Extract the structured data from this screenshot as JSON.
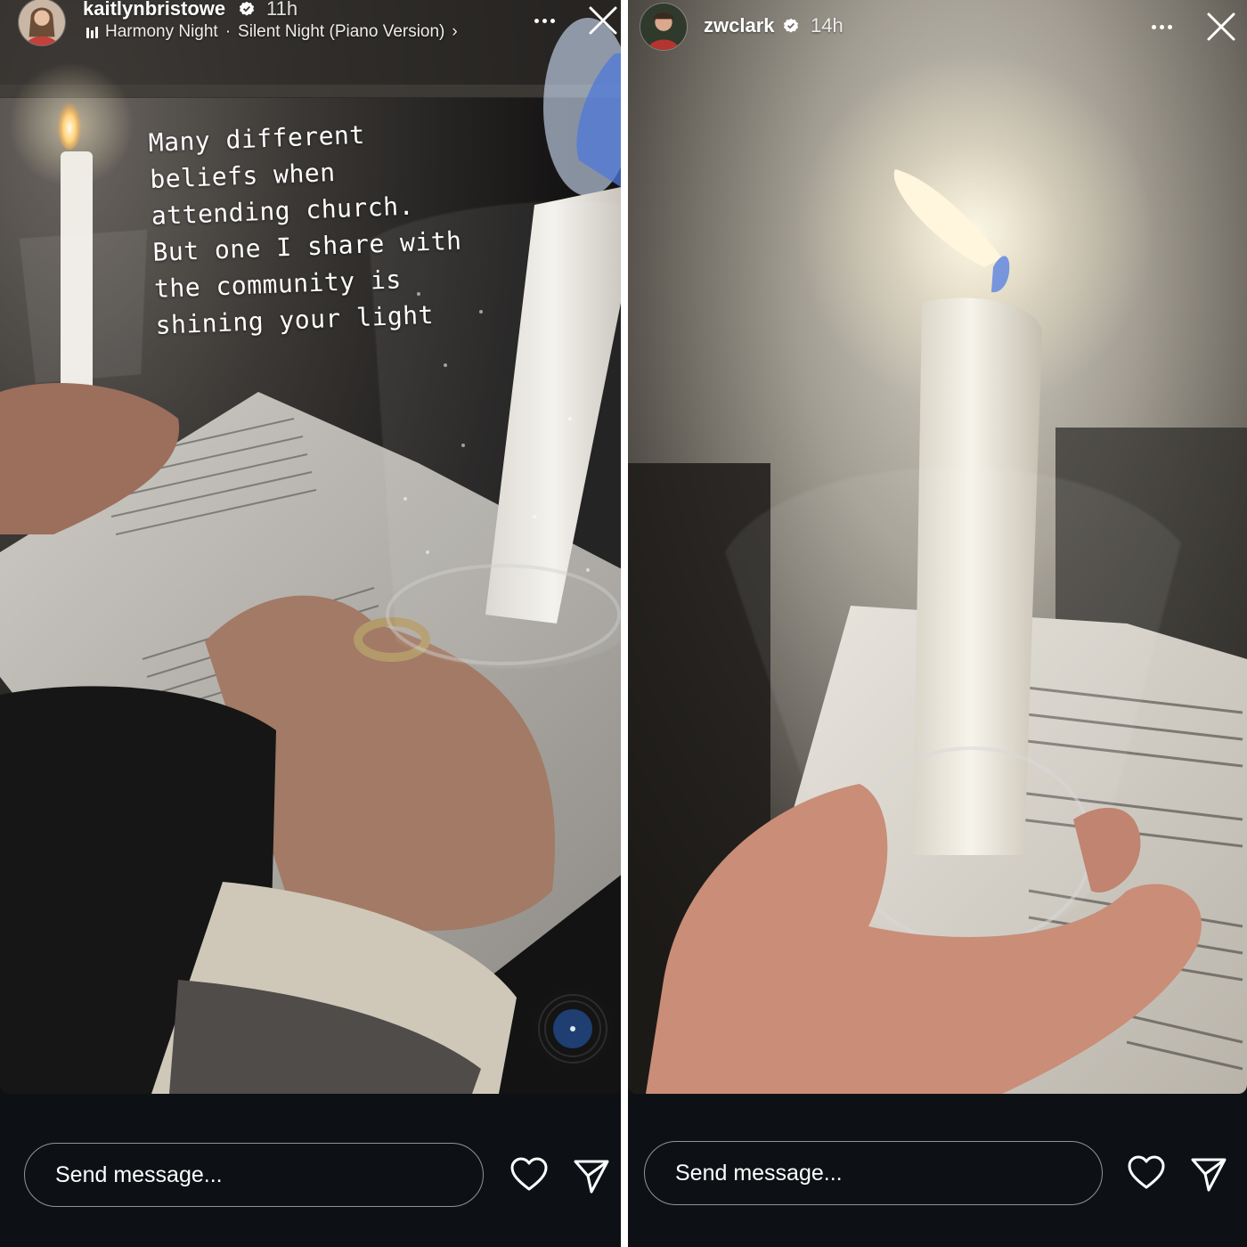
{
  "stories": [
    {
      "username": "kaitlynbristowe",
      "verified": true,
      "time": "11h",
      "music": {
        "artist": "Harmony Night",
        "separator": "·",
        "track": "Silent Night (Piano Version)",
        "chevron": "›"
      },
      "caption_lines": [
        "Many different",
        "beliefs when",
        "attending church.",
        "But one I share with",
        "the community is",
        "shining your light"
      ],
      "sticker_icon": "vinyl-record-icon",
      "message_placeholder": "Send message...",
      "icons": [
        "more-icon",
        "close-icon",
        "heart-icon",
        "send-icon",
        "verified-badge-icon",
        "music-bars-icon"
      ]
    },
    {
      "username": "zwclark",
      "verified": true,
      "time": "14h",
      "message_placeholder": "Send message...",
      "icons": [
        "more-icon",
        "close-icon",
        "heart-icon",
        "send-icon",
        "verified-badge-icon"
      ]
    }
  ],
  "colors": {
    "background": "#0d1116",
    "divider": "#ffffff",
    "text": "#ffffff"
  }
}
